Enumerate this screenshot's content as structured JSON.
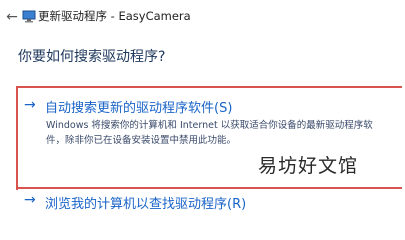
{
  "window": {
    "title": "更新驱动程序 - EasyCamera"
  },
  "main": {
    "question": "你要如何搜索驱动程序?",
    "options": [
      {
        "title": "自动搜索更新的驱动程序软件(S)",
        "description_line1": "Windows 将搜索你的计算机和 Internet 以获取适合你设备的最新驱动程序软",
        "description_line2": "件，除非你已在设备安装设置中禁用此功能。"
      },
      {
        "title": "浏览我的计算机以查找驱动程序(R)"
      }
    ]
  },
  "watermark": {
    "text": "易坊好文馆"
  },
  "colors": {
    "accent": "#1a64c8",
    "highlight_border": "#d9534f"
  }
}
